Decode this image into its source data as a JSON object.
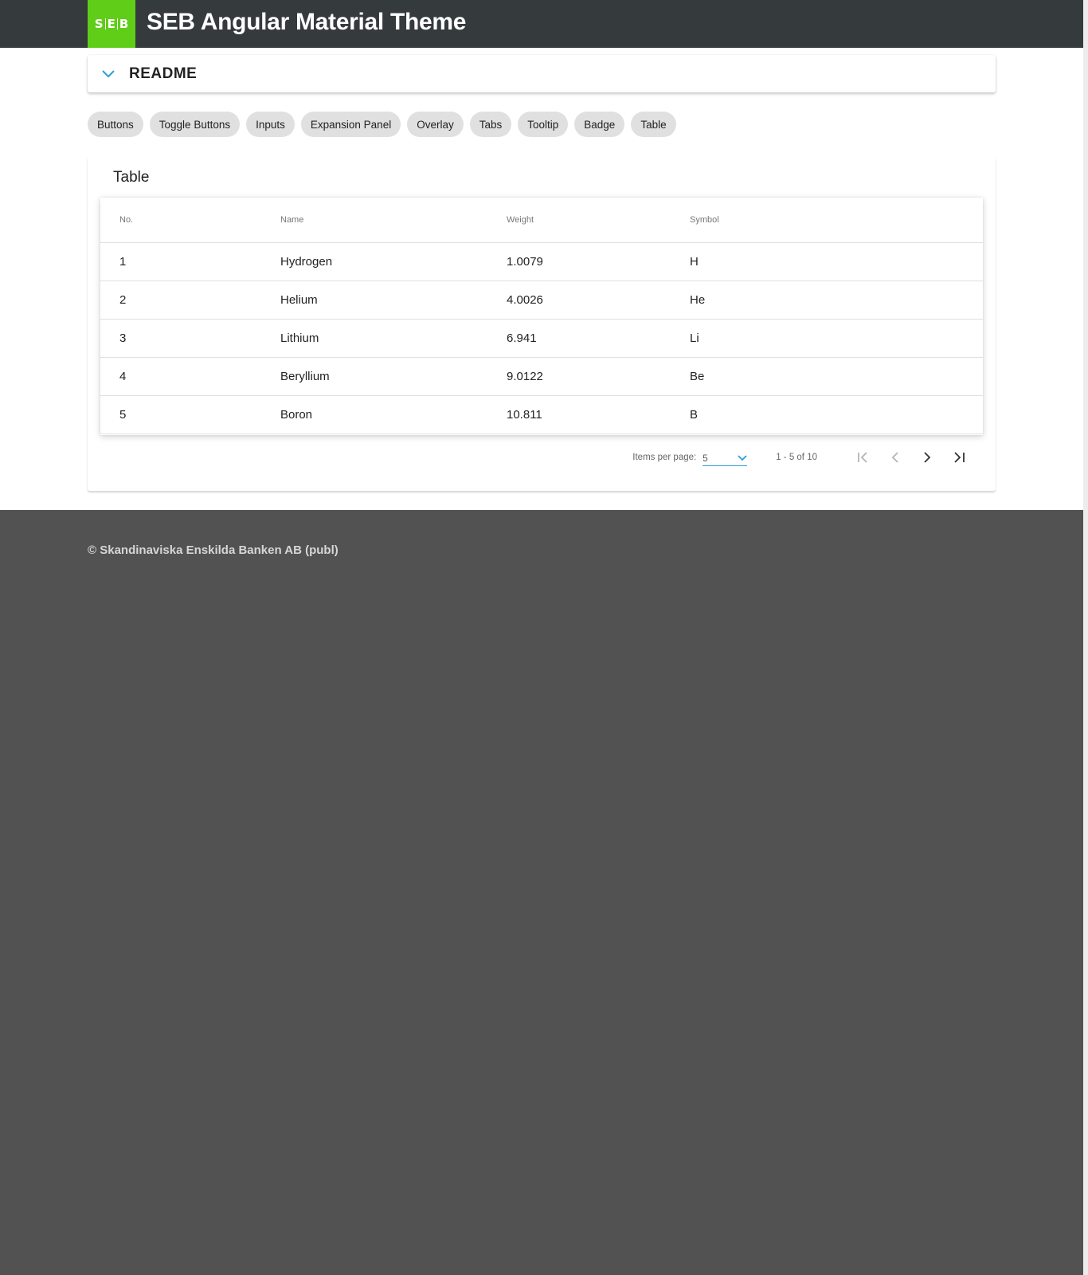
{
  "header": {
    "logo_text": "SEB",
    "title": "SEB Angular Material Theme",
    "logo_color": "#60cd18",
    "bar_color": "#353a3d"
  },
  "readme": {
    "title": "README",
    "icon": "chevron-down-icon"
  },
  "nav_chips": [
    {
      "label": "Buttons"
    },
    {
      "label": "Toggle Buttons"
    },
    {
      "label": "Inputs"
    },
    {
      "label": "Expansion Panel"
    },
    {
      "label": "Overlay"
    },
    {
      "label": "Tabs"
    },
    {
      "label": "Tooltip"
    },
    {
      "label": "Badge"
    },
    {
      "label": "Table"
    }
  ],
  "table_section": {
    "title": "Table",
    "columns": [
      "No.",
      "Name",
      "Weight",
      "Symbol"
    ],
    "rows": [
      {
        "no": "1",
        "name": "Hydrogen",
        "weight": "1.0079",
        "symbol": "H"
      },
      {
        "no": "2",
        "name": "Helium",
        "weight": "4.0026",
        "symbol": "He"
      },
      {
        "no": "3",
        "name": "Lithium",
        "weight": "6.941",
        "symbol": "Li"
      },
      {
        "no": "4",
        "name": "Beryllium",
        "weight": "9.0122",
        "symbol": "Be"
      },
      {
        "no": "5",
        "name": "Boron",
        "weight": "10.811",
        "symbol": "B"
      }
    ],
    "paginator": {
      "items_per_page_label": "Items per page:",
      "page_size": "5",
      "range_label": "1 - 5 of 10"
    }
  },
  "footer": {
    "text": "© Skandinaviska Enskilda Banken AB (publ)"
  },
  "colors": {
    "accent": "#2a9fd8",
    "footer_bg": "#525252"
  }
}
